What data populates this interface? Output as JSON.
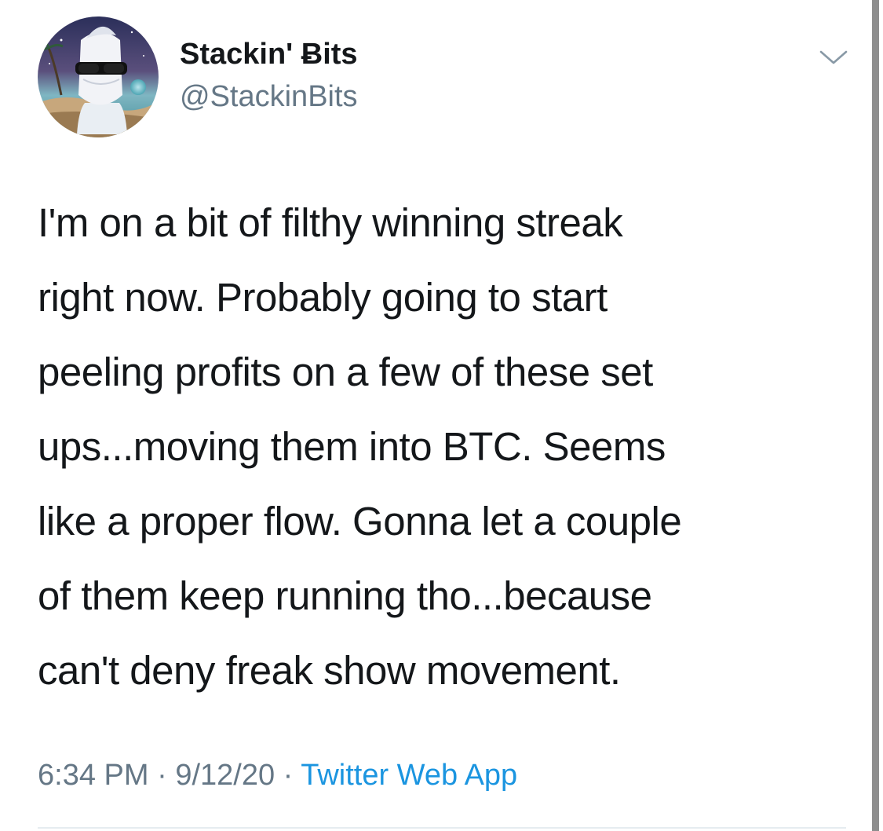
{
  "tweet": {
    "display_name": "Stackin' Ƀits",
    "handle": "@StackinBits",
    "text": "I'm on a bit of filthy winning streak\nright now. Probably going to start\npeeling profits on a few of these set\nups...moving them into BTC. Seems\nlike a proper flow. Gonna let a couple\nof them keep running tho...because\ncan't deny freak show movement.",
    "time": "6:34 PM",
    "separator": "·",
    "date": "9/12/20",
    "source": "Twitter Web App"
  },
  "icons": {
    "more": "chevron-down-icon"
  },
  "colors": {
    "text_primary": "#14171a",
    "text_secondary": "#657786",
    "link": "#1b95e0",
    "divider": "#e6ecf0"
  }
}
